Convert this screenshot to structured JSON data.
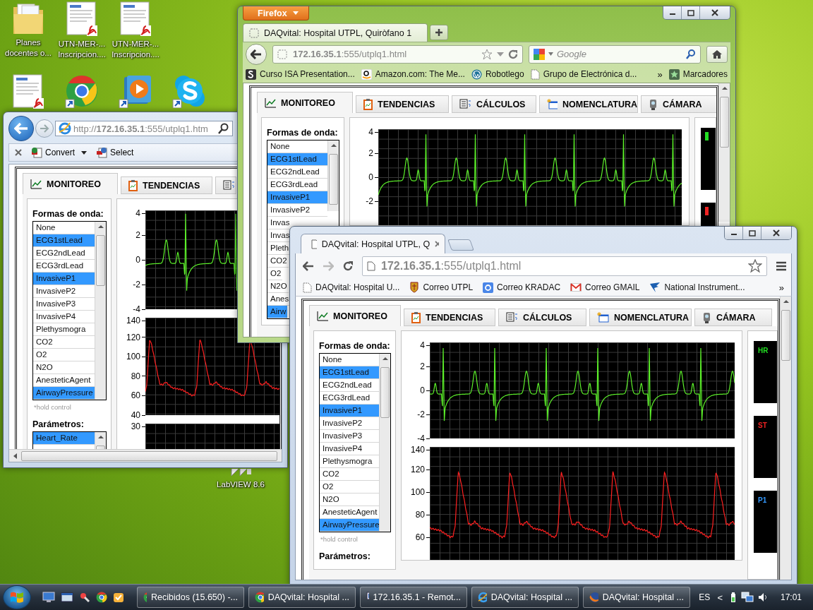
{
  "desktop_icons": [
    {
      "kind": "folder",
      "label_lines": [
        "Planes",
        "docentes o..."
      ]
    },
    {
      "kind": "pdf",
      "label_lines": [
        "UTN-MER-...",
        "Inscripcion...."
      ]
    },
    {
      "kind": "pdf",
      "label_lines": [
        "UTN-MER-...",
        "Inscripcion...."
      ]
    },
    {
      "kind": "pdf"
    },
    {
      "kind": "chrome"
    },
    {
      "kind": "media"
    },
    {
      "kind": "skype"
    },
    {
      "kind": "labview",
      "label_lines": [
        "LabVIEW 8.6"
      ]
    }
  ],
  "ie_window": {
    "address": "http://**172.16.35.1**:555/utplq1.htm",
    "toolbar": [
      "Convert",
      "Select"
    ],
    "page": {
      "tabs": [
        {
          "label": "MONITOREO",
          "kind": "monitor",
          "selected": true
        },
        {
          "label": "TENDENCIAS",
          "kind": "trend",
          "selected": false
        },
        {
          "kind": "calc",
          "selected": false
        }
      ],
      "waveform_title": "Formas de onda:",
      "waveforms": [
        {
          "label": "None",
          "selected": false
        },
        {
          "label": "ECG1stLead",
          "selected": true
        },
        {
          "label": "ECG2ndLead",
          "selected": false
        },
        {
          "label": "ECG3rdLead",
          "selected": false
        },
        {
          "label": "InvasiveP1",
          "selected": true
        },
        {
          "label": "InvasiveP2",
          "selected": false
        },
        {
          "label": "InvasiveP3",
          "selected": false
        },
        {
          "label": "InvasiveP4",
          "selected": false
        },
        {
          "label": "Plethysmogra",
          "selected": false
        },
        {
          "label": "CO2",
          "selected": false
        },
        {
          "label": "O2",
          "selected": false
        },
        {
          "label": "N2O",
          "selected": false
        },
        {
          "label": "AnesteticAgent",
          "selected": false
        },
        {
          "label": "AirwayPressure",
          "selected": true
        }
      ],
      "hold_note": "*hold control",
      "params_title": "Parámetros:",
      "params": [
        {
          "label": "Heart_Rate",
          "selected": true
        }
      ],
      "charts": [
        {
          "kind": "ecg",
          "y_ticks": [
            "4",
            "2",
            "0",
            "-2",
            "-4"
          ]
        },
        {
          "kind": "pressure",
          "y_ticks": [
            "140",
            "120",
            "100",
            "80",
            "60",
            "40"
          ]
        },
        {
          "kind": "blank",
          "y_ticks": [
            "30"
          ]
        }
      ]
    }
  },
  "firefox_window": {
    "menu_button": "Firefox",
    "tab": {
      "title": "DAQvital: Hospital UTPL, Quiròfano 1"
    },
    "address": "**172.16.35.1**:555/utplq1.html",
    "search": {
      "placeholder": "Google"
    },
    "bookmarks": [
      {
        "kind": "s",
        "label": "Curso ISA Presentation..."
      },
      {
        "kind": "amazon",
        "label": "Amazon.com: The Me..."
      },
      {
        "kind": "wp",
        "label": "Robotlego"
      },
      {
        "kind": "page",
        "label": "Grupo de Electrónica d..."
      }
    ],
    "bookmarks_more": "»",
    "bookmarks_menu": "Marcadores",
    "page": {
      "tabs": [
        {
          "label": "MONITOREO",
          "kind": "monitor",
          "selected": true
        },
        {
          "label": "TENDENCIAS",
          "kind": "trend",
          "selected": false
        },
        {
          "label": "CÁLCULOS",
          "kind": "calc",
          "selected": false
        },
        {
          "label": "NOMENCLATURA",
          "kind": "names",
          "selected": false
        },
        {
          "label": "CÁMARA",
          "kind": "camera",
          "selected": false
        }
      ],
      "waveform_title": "Formas de onda:",
      "waveforms": [
        {
          "label": "None",
          "selected": false
        },
        {
          "label": "ECG1stLead",
          "selected": true
        },
        {
          "label": "ECG2ndLead",
          "selected": false
        },
        {
          "label": "ECG3rdLead",
          "selected": false
        },
        {
          "label": "InvasiveP1",
          "selected": true
        },
        {
          "label": "InvasiveP2",
          "selected": false
        },
        {
          "label": "Invas",
          "selected": false
        },
        {
          "label": "Invas",
          "selected": false
        },
        {
          "label": "Pleth",
          "selected": false
        },
        {
          "label": "CO2",
          "selected": false
        },
        {
          "label": "O2",
          "selected": false
        },
        {
          "label": "N2O",
          "selected": false
        },
        {
          "label": "Anes",
          "selected": false
        },
        {
          "label": "Airw",
          "selected": true
        }
      ],
      "charts": [
        {
          "kind": "ecg",
          "y_ticks": [
            "4",
            "2",
            "0",
            "-2"
          ]
        }
      ],
      "readouts": [
        {
          "color": "#22dd22"
        },
        {
          "color": "#ee2222"
        }
      ]
    }
  },
  "chrome_window": {
    "tab": {
      "title": "DAQvital: Hospital UTPL, Q"
    },
    "address": "**172.16.35.1**:555/utplq1.html",
    "bookmarks": [
      {
        "kind": "page",
        "label": "DAQvital: Hospital U..."
      },
      {
        "kind": "crest",
        "label": "Correo UTPL"
      },
      {
        "kind": "g",
        "label": "Correo KRADAC"
      },
      {
        "kind": "mail",
        "label": "Correo GMAIL"
      },
      {
        "kind": "eagle",
        "label": "National Instrument..."
      }
    ],
    "bookmarks_more": "»",
    "page": {
      "tabs": [
        {
          "label": "MONITOREO",
          "kind": "monitor",
          "selected": true
        },
        {
          "label": "TENDENCIAS",
          "kind": "trend",
          "selected": false
        },
        {
          "label": "CÁLCULOS",
          "kind": "calc",
          "selected": false
        },
        {
          "label": "NOMENCLATURA",
          "kind": "names",
          "selected": false
        },
        {
          "label": "CÁMARA",
          "kind": "camera",
          "selected": false
        }
      ],
      "waveform_title": "Formas de onda:",
      "waveforms": [
        {
          "label": "None",
          "selected": false
        },
        {
          "label": "ECG1stLead",
          "selected": true
        },
        {
          "label": "ECG2ndLead",
          "selected": false
        },
        {
          "label": "ECG3rdLead",
          "selected": false
        },
        {
          "label": "InvasiveP1",
          "selected": true
        },
        {
          "label": "InvasiveP2",
          "selected": false
        },
        {
          "label": "InvasiveP3",
          "selected": false
        },
        {
          "label": "InvasiveP4",
          "selected": false
        },
        {
          "label": "Plethysmogra",
          "selected": false
        },
        {
          "label": "CO2",
          "selected": false
        },
        {
          "label": "O2",
          "selected": false
        },
        {
          "label": "N2O",
          "selected": false
        },
        {
          "label": "AnesteticAgent",
          "selected": false
        },
        {
          "label": "AirwayPressure",
          "selected": true
        }
      ],
      "hold_note": "*hold control",
      "params_title": "Parámetros:",
      "charts": [
        {
          "kind": "ecg",
          "y_ticks": [
            "4",
            "2",
            "0",
            "-2",
            "-4"
          ]
        },
        {
          "kind": "pressure",
          "y_ticks": [
            "140",
            "120",
            "100",
            "80",
            "60"
          ]
        }
      ],
      "readouts": [
        {
          "label": "HR",
          "color": "#22dd22"
        },
        {
          "label": "ST",
          "color": "#ee2222"
        },
        {
          "label": "P1",
          "color": "#3399ff"
        }
      ]
    }
  },
  "taskbar": {
    "tasks": [
      {
        "kind": "chrome",
        "label": "Recibidos (15.650) -..."
      },
      {
        "kind": "chrome",
        "label": "DAQvital: Hospital ..."
      },
      {
        "kind": "remote",
        "label": "172.16.35.1 - Remot..."
      },
      {
        "kind": "ie",
        "label": "DAQvital: Hospital ..."
      },
      {
        "kind": "firefox",
        "label": "DAQvital: Hospital ..."
      }
    ],
    "language": "ES",
    "tray_expand": "<",
    "clock": "17:01"
  }
}
